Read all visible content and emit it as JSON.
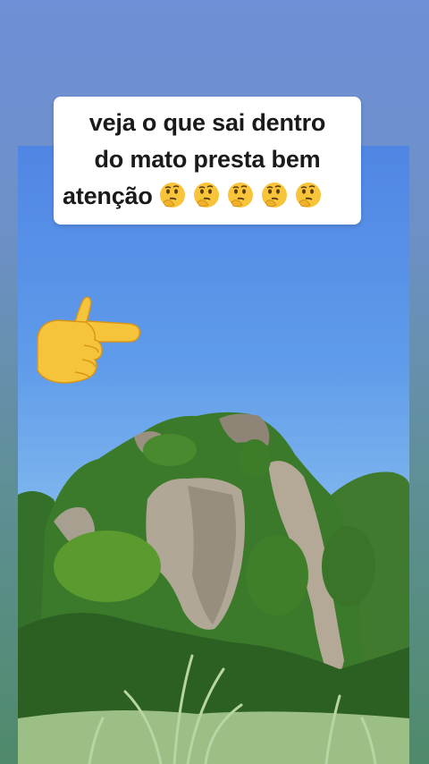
{
  "caption": {
    "line1": "veja o que sai dentro",
    "line2": "do mato presta bem",
    "line3": "atenção",
    "emojis": [
      "thinking-face-emoji",
      "thinking-face-emoji",
      "thinking-face-emoji",
      "thinking-face-emoji",
      "thinking-face-emoji"
    ]
  },
  "pointer_emoji": "backhand-index-pointing-right-emoji",
  "scene": "limestone-cliff-covered-in-vegetation-under-blue-sky-with-tall-grass-foreground",
  "colors": {
    "sky_top": "#4f86e4",
    "sky_bottom": "#9ccff0",
    "vegetation": "#3e7a2a",
    "rock": "#a69a8a",
    "caption_bg": "#ffffff",
    "caption_text": "#1a1a1a"
  }
}
